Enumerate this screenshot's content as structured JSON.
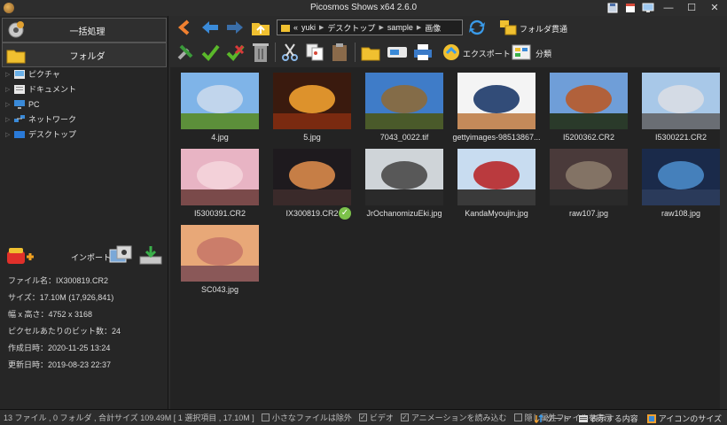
{
  "window": {
    "title": "Picosmos Shows x64 2.6.0"
  },
  "left_panel": {
    "batch_button": "一括処理",
    "folder_button": "フォルダ",
    "tree": [
      {
        "label": "ピクチャ",
        "icon": "pictures-folder-icon"
      },
      {
        "label": "ドキュメント",
        "icon": "documents-folder-icon"
      },
      {
        "label": "PC",
        "icon": "pc-icon"
      },
      {
        "label": "ネットワーク",
        "icon": "network-icon"
      },
      {
        "label": "デスクトップ",
        "icon": "desktop-folder-icon"
      }
    ],
    "import_label": "インポート",
    "info": [
      "ファイル名：IX300819.CR2",
      "サイズ：17.10M (17,926,841)",
      "幅 x 高さ：4752 x 3168",
      "ピクセルあたりのビット数：24",
      "作成日時：2020-11-25 13:24",
      "更新日時：2019-08-23 22:37"
    ]
  },
  "toolbar": {
    "path": [
      "«",
      "yuki",
      "デスクトップ",
      "sample",
      "画像"
    ],
    "folder_through": "フォルダ貫通",
    "export": "エクスポート",
    "classify": "分類"
  },
  "thumbnails": [
    {
      "name": "4.jpg",
      "colors": [
        "#7fb4e8",
        "#c9d8ec",
        "#5c8f3a"
      ],
      "selected": false
    },
    {
      "name": "5.jpg",
      "colors": [
        "#3a1a0e",
        "#f0a030",
        "#7a2a10"
      ],
      "selected": false
    },
    {
      "name": "7043_0022.tif",
      "colors": [
        "#3f7cc8",
        "#8c6a3a",
        "#4a5a2a"
      ],
      "selected": false
    },
    {
      "name": "gettyimages-98513867...",
      "colors": [
        "#f4f4f4",
        "#1d3a6a",
        "#c48a5a"
      ],
      "selected": false
    },
    {
      "name": "I5200362.CR2",
      "colors": [
        "#6f9ed8",
        "#b85a2a",
        "#2a3a2a"
      ],
      "selected": false
    },
    {
      "name": "I5300221.CR2",
      "colors": [
        "#a8c8e8",
        "#d8dde4",
        "#6a6e74"
      ],
      "selected": false
    },
    {
      "name": "I5300391.CR2",
      "colors": [
        "#e8b4c4",
        "#f4d4dc",
        "#7a4a4a"
      ],
      "selected": false
    },
    {
      "name": "IX300819.CR2",
      "colors": [
        "#1e1a1e",
        "#d88a4a",
        "#3a2a2a"
      ],
      "selected": true
    },
    {
      "name": "JrOchanomizuEki.jpg",
      "colors": [
        "#cfd4d8",
        "#4a4a4a",
        "#2a2a2a"
      ],
      "selected": false
    },
    {
      "name": "KandaMyoujin.jpg",
      "colors": [
        "#c8dcf0",
        "#b8282a",
        "#3a3a3a"
      ],
      "selected": false
    },
    {
      "name": "raw107.jpg",
      "colors": [
        "#4a3a3a",
        "#8a7a6a",
        "#2a2a2a"
      ],
      "selected": false
    },
    {
      "name": "raw108.jpg",
      "colors": [
        "#1a2a4a",
        "#4a8ac8",
        "#2a3a5a"
      ],
      "selected": false
    },
    {
      "name": "SC043.jpg",
      "colors": [
        "#e8a878",
        "#c87868",
        "#8a5858"
      ],
      "selected": false
    }
  ],
  "status": {
    "summary": "13 ファイル , 0 フォルダ , 合計サイズ 109.49M [ 1 選択項目 , 17.10M ]",
    "options": [
      {
        "label": "小さなファイルは除外",
        "checked": false
      },
      {
        "label": "ビデオ",
        "checked": true
      },
      {
        "label": "アニメーションを読み込む",
        "checked": true
      },
      {
        "label": "隠し属性ファイルを表示",
        "checked": false
      }
    ],
    "sort": "ソート",
    "display_content": "表示する内容",
    "icon_size": "アイコンのサイズ"
  }
}
